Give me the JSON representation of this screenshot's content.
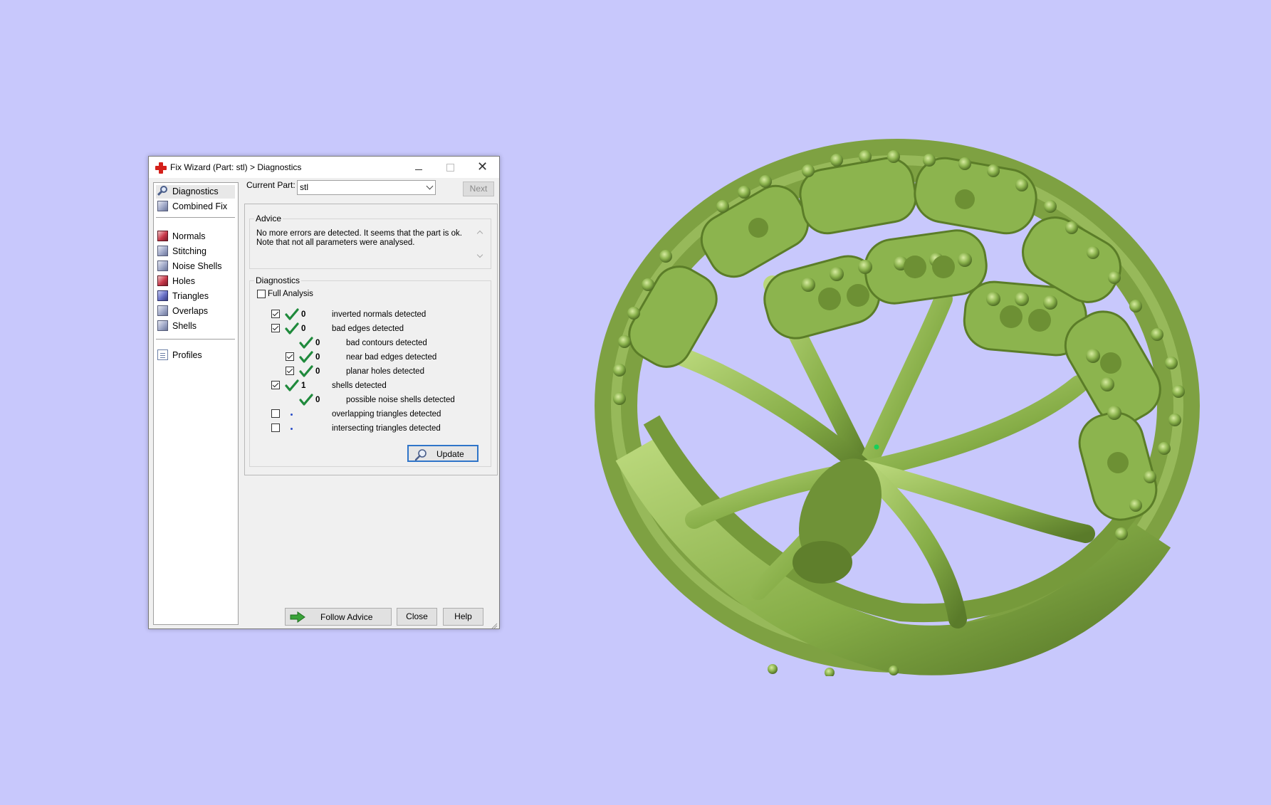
{
  "window": {
    "title": "Fix Wizard (Part: stl) > Diagnostics",
    "close_glyph": "✕"
  },
  "nav": {
    "items": [
      {
        "label": "Diagnostics",
        "icon": "magnifier-icon"
      },
      {
        "label": "Combined Fix",
        "icon": "cube-icon"
      },
      {
        "label": "Normals",
        "icon": "cube-red-icon"
      },
      {
        "label": "Stitching",
        "icon": "cube-icon"
      },
      {
        "label": "Noise Shells",
        "icon": "cube-icon"
      },
      {
        "label": "Holes",
        "icon": "cube-red-icon"
      },
      {
        "label": "Triangles",
        "icon": "cube-blue-icon"
      },
      {
        "label": "Overlaps",
        "icon": "cube-icon"
      },
      {
        "label": "Shells",
        "icon": "cube-icon"
      },
      {
        "label": "Profiles",
        "icon": "document-icon"
      }
    ],
    "selected": "Diagnostics"
  },
  "current_part": {
    "label": "Current Part:",
    "value": "stl",
    "next_label": "Next"
  },
  "advice": {
    "title": "Advice",
    "text": "No more errors are detected. It seems that the part is ok. Note that not all parameters were analysed."
  },
  "diagnostics": {
    "title": "Diagnostics",
    "full_analysis_label": "Full Analysis",
    "full_analysis_checked": false,
    "rows": [
      {
        "count": "0",
        "desc": "inverted normals detected"
      },
      {
        "count": "0",
        "desc": "bad edges detected"
      },
      {
        "count": "0",
        "desc": "bad contours detected"
      },
      {
        "count": "0",
        "desc": "near bad edges detected"
      },
      {
        "count": "0",
        "desc": "planar holes detected"
      },
      {
        "count": "1",
        "desc": "shells detected"
      },
      {
        "count": "0",
        "desc": "possible noise shells detected"
      },
      {
        "count": "",
        "desc": "overlapping triangles detected"
      },
      {
        "count": "",
        "desc": "intersecting triangles detected"
      }
    ],
    "update_label": "Update"
  },
  "footer": {
    "follow_advice_label": "Follow Advice",
    "close_label": "Close",
    "help_label": "Help"
  },
  "colors": {
    "desktop_bg": "#c8c8fc",
    "model_green": "#8cb44e",
    "check_green": "#1f8a3c",
    "accent_red": "#d4201a"
  }
}
